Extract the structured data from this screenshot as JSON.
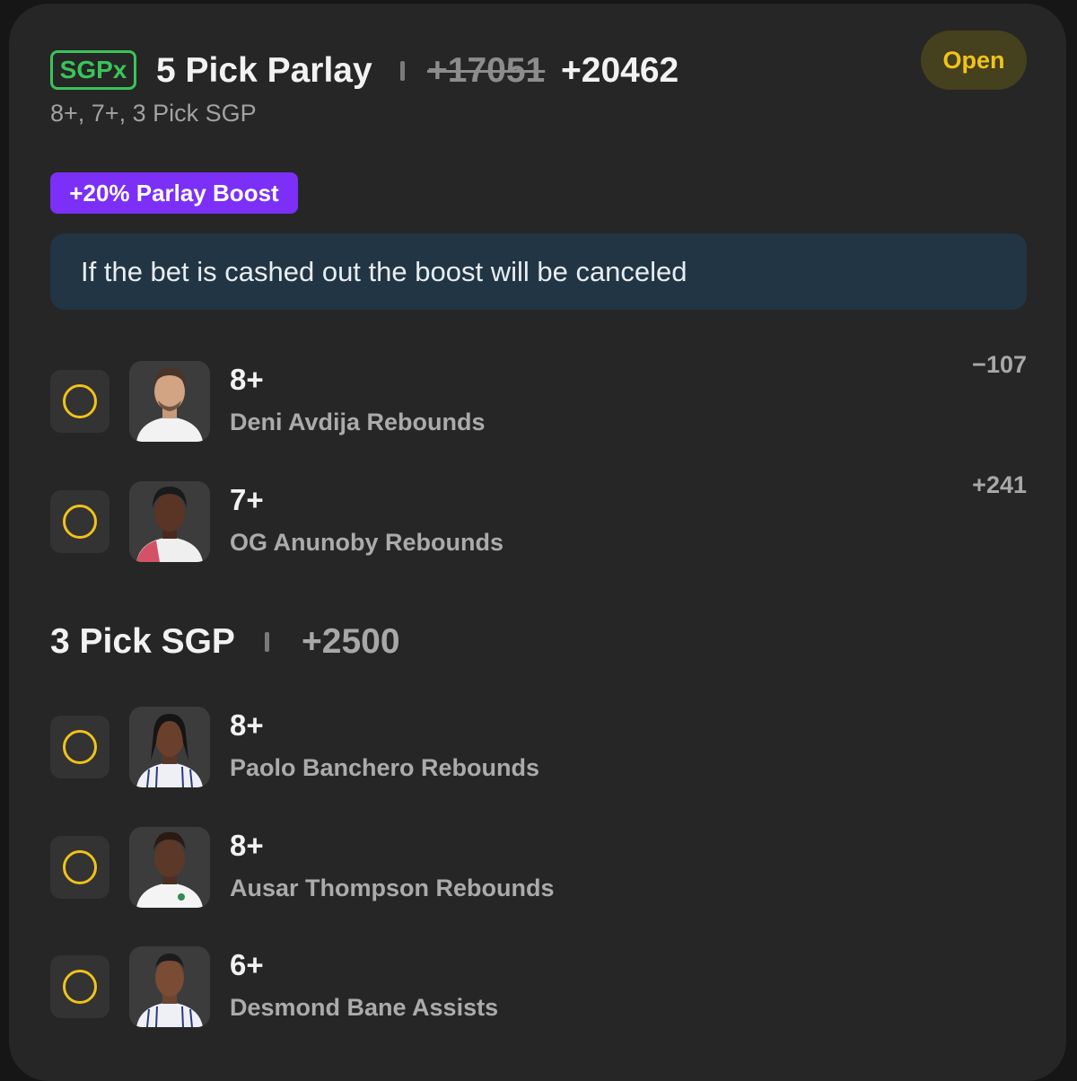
{
  "header": {
    "badge": "SGPx",
    "title": "5 Pick Parlay",
    "original_odds": "+17051",
    "boosted_odds": "+20462",
    "status": "Open",
    "subtitle": "8+, 7+, 3 Pick SGP"
  },
  "boost": {
    "label": "+20% Parlay Boost",
    "notice": "If the bet is cashed out the boost will be canceled"
  },
  "legs": [
    {
      "line": "8+",
      "market": "Deni Avdija Rebounds",
      "odds": "−107",
      "avatar": "player-headshot"
    },
    {
      "line": "7+",
      "market": "OG Anunoby Rebounds",
      "odds": "+241",
      "avatar": "player-headshot"
    }
  ],
  "sgp": {
    "title": "3 Pick SGP",
    "odds": "+2500",
    "legs": [
      {
        "line": "8+",
        "market": "Paolo Banchero Rebounds",
        "avatar": "player-headshot"
      },
      {
        "line": "8+",
        "market": "Ausar Thompson Rebounds",
        "avatar": "player-headshot"
      },
      {
        "line": "6+",
        "market": "Desmond Bane Assists",
        "avatar": "player-headshot"
      }
    ]
  },
  "colors": {
    "background": "#262626",
    "accent_yellow": "#f1c21b",
    "sgpx_green": "#39c45a",
    "boost_purple": "#7b2ff7",
    "notice_bg": "#213545"
  }
}
